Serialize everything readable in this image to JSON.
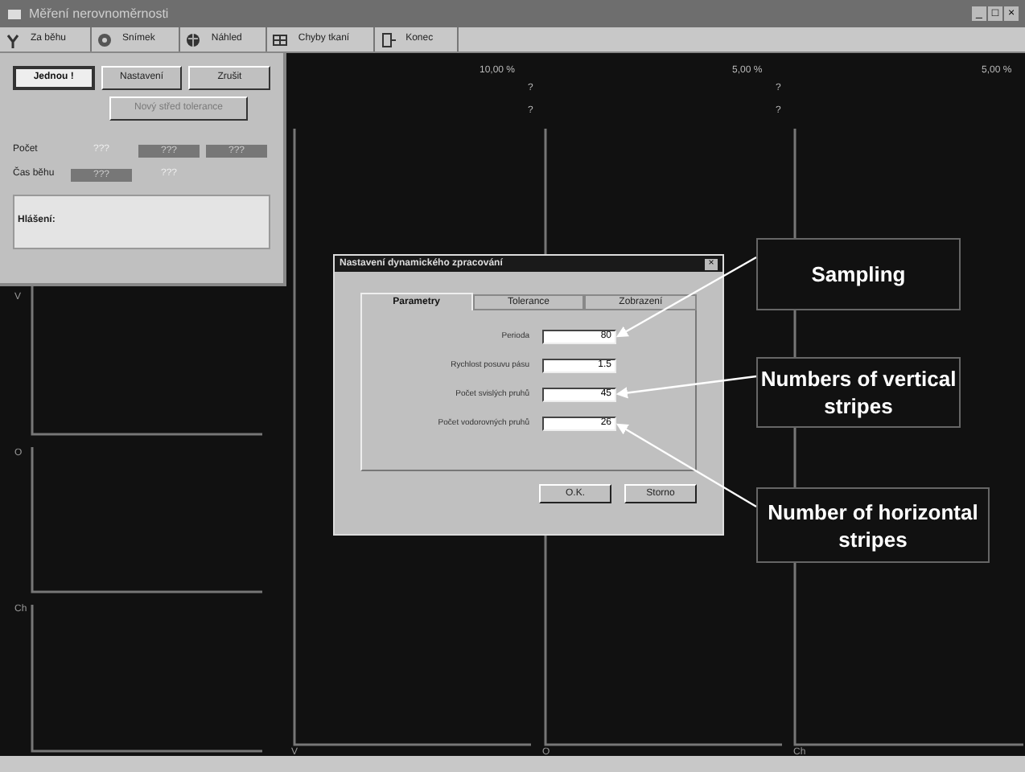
{
  "window": {
    "title": "Měření nerovnoměrnosti",
    "controls": [
      "_",
      "□",
      "×"
    ]
  },
  "toolbar": [
    {
      "label": "Za běhu"
    },
    {
      "label": "Snímek"
    },
    {
      "label": "Náhled"
    },
    {
      "label": "Chyby tkaní"
    },
    {
      "label": "Konec"
    }
  ],
  "panel": {
    "buttons": [
      {
        "label": "Jednou !",
        "kind": "default"
      },
      {
        "label": "Nastavení",
        "kind": "normal"
      },
      {
        "label": "Zrušit",
        "kind": "normal"
      },
      {
        "label": "Nový střed tolerance",
        "kind": "disabled"
      }
    ],
    "rows": [
      {
        "label": "Počet",
        "values": [
          {
            "text": "???",
            "kind": "plain"
          },
          {
            "text": "???",
            "kind": "box"
          },
          {
            "text": "???",
            "kind": "box"
          }
        ]
      },
      {
        "label": "Čas běhu",
        "values": [
          {
            "text": "???",
            "kind": "box"
          },
          {
            "text": "???",
            "kind": "plain"
          }
        ]
      }
    ],
    "message_label": "Hlášení:"
  },
  "plots": {
    "columns": [
      {
        "header": "10,00 %",
        "marks": [
          "?",
          "?"
        ],
        "axis_label": "V"
      },
      {
        "header": "5,00 %",
        "marks": [
          "?",
          "?"
        ],
        "axis_label": "O"
      },
      {
        "header": "5,00 %",
        "axis_label": "Ch"
      }
    ],
    "side_labels": [
      "V",
      "O",
      "Ch"
    ]
  },
  "dialog": {
    "title": "Nastavení dynamického zpracování",
    "close": "×",
    "tabs": [
      {
        "label": "Parametry",
        "selected": true
      },
      {
        "label": "Tolerance",
        "selected": false
      },
      {
        "label": "Zobrazení",
        "selected": false
      }
    ],
    "fields": [
      {
        "label": "Perioda",
        "value": "80"
      },
      {
        "label": "Rychlost posuvu pásu",
        "value": "1.5"
      },
      {
        "label": "Počet svislých pruhů",
        "value": "45"
      },
      {
        "label": "Počet vodorovných pruhů",
        "value": "26"
      }
    ],
    "buttons": [
      "O.K.",
      "Storno"
    ]
  },
  "callouts": [
    {
      "text": "Sampling"
    },
    {
      "text": "Numbers of vertical stripes"
    },
    {
      "text": "Number of horizontal stripes"
    }
  ]
}
